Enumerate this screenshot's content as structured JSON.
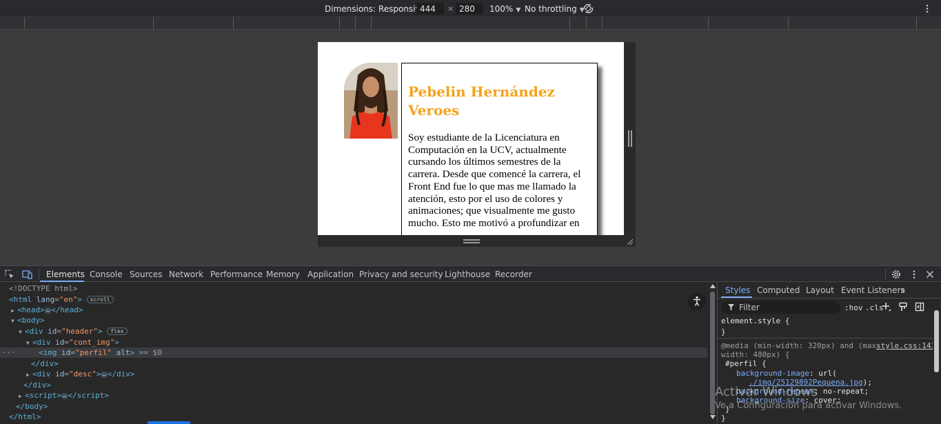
{
  "device_toolbar": {
    "dimensions_label": "Dimensions: Responsive",
    "width_value": "444",
    "times_symbol": "×",
    "height_value": "280",
    "zoom_label": "100%",
    "throttling_label": "No throttling"
  },
  "viewport_page": {
    "name": "Pebelin Hernández Veroes",
    "description": "Soy estudiante de la Licenciatura en Computación en la UCV, actualmente cursando los últimos semestres de la carrera. Desde que comencé la carrera, el Front End fue lo que mas me llamado la atención, esto por el uso de colores y animaciones; que visualmente me gusto mucho. Esto me motivó a profundizar en"
  },
  "devtools": {
    "tabs": [
      "Elements",
      "Console",
      "Sources",
      "Network",
      "Performance",
      "Memory",
      "Application",
      "Privacy and security",
      "Lighthouse",
      "Recorder"
    ],
    "active_tab": "Elements",
    "dom": {
      "doctype": "<!DOCTYPE html>",
      "html_tag": "html",
      "html_attr": "lang",
      "html_val": "\"en\"",
      "scroll_badge": "scroll",
      "head_tag": "head",
      "body_tag": "body",
      "header_div": "div",
      "id_attr": "id",
      "header_id": "\"header\"",
      "flex_badge": "flex",
      "cont_img_id": "\"cont_img\"",
      "img_tag": "img",
      "perfil_id": "\"perfil\"",
      "alt_attr": "alt",
      "selected_suffix": "== $0",
      "desc_id": "\"desc\"",
      "script_tag": "script",
      "ellipsis": "…",
      "close_div": "</div>",
      "close_body": "</body>",
      "close_html": "</html>"
    },
    "styles_tabs": [
      "Styles",
      "Computed",
      "Layout",
      "Event Listeners"
    ],
    "filter_placeholder": "Filter",
    "hov_label": ":hov",
    "cls_label": ".cls",
    "element_style": "element.style {",
    "close_brace": "}",
    "media_rule_1": "@media (min-width: 320px) and (max-",
    "media_rule_2": "width: 480px) {",
    "source_link": "style.css:143",
    "selector": "#perfil {",
    "bg_image_prop": "background-image",
    "bg_image_val": "url(",
    "bg_image_url": "./img/25129892Pequena.jpg",
    "bg_image_close": ");",
    "bg_repeat_prop": "background-repeat",
    "bg_repeat_val": "no-repeat;",
    "bg_size_prop": "background-size",
    "bg_size_val": "cover;"
  },
  "watermark": {
    "line1": "Activar Windows",
    "line2": "Ve a Configuración para activar Windows."
  }
}
